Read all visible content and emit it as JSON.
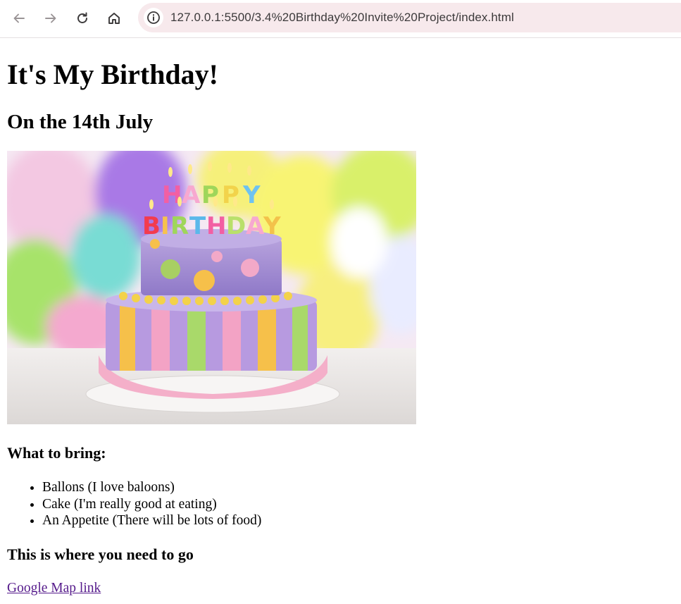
{
  "browser": {
    "url": "127.0.0.1:5500/3.4%20Birthday%20Invite%20Project/index.html",
    "icons": [
      "back-arrow-icon",
      "forward-arrow-icon",
      "reload-icon",
      "home-icon",
      "site-info-icon"
    ]
  },
  "page": {
    "title": "It's My Birthday!",
    "date": "On the 14th July",
    "bring_heading": "What to bring:",
    "bring_items": [
      "Ballons (I love baloons)",
      "Cake (I'm really good at eating)",
      "An Appetite (There will be lots of food)"
    ],
    "where_heading": "This is where you need to go",
    "map_link": "Google Map link",
    "cake_candles_text": "HAPPY BIRTHDAY"
  },
  "colors": {
    "visited_link": "#551a8b",
    "omnibox_bg": "#f7e9ec"
  }
}
